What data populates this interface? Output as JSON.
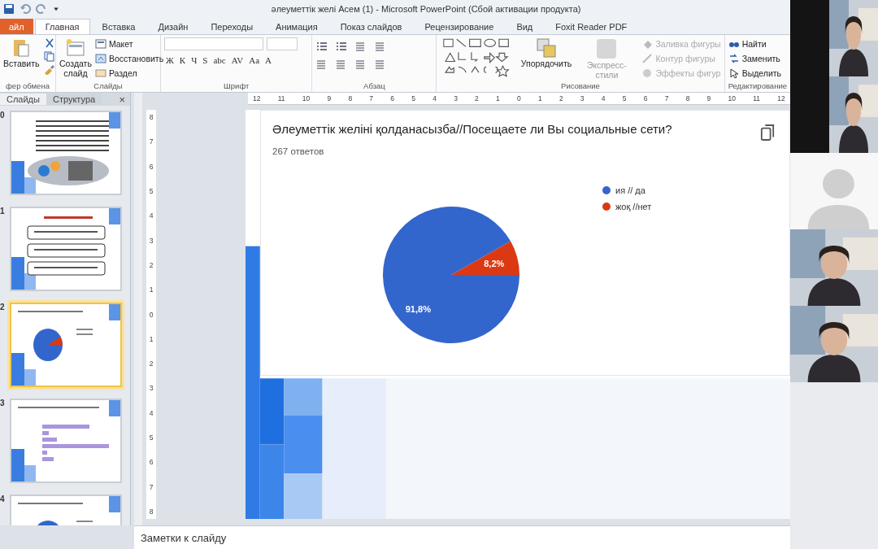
{
  "window": {
    "title": "әлеуметтік желі Асем (1)  -  Microsoft PowerPoint (Сбой активации продукта)"
  },
  "ribbon_tabs": [
    {
      "label": "айл",
      "kind": "file",
      "selected": false
    },
    {
      "label": "Главная",
      "kind": "tab",
      "selected": true
    },
    {
      "label": "Вставка",
      "kind": "tab",
      "selected": false
    },
    {
      "label": "Дизайн",
      "kind": "tab",
      "selected": false
    },
    {
      "label": "Переходы",
      "kind": "tab",
      "selected": false
    },
    {
      "label": "Анимация",
      "kind": "tab",
      "selected": false
    },
    {
      "label": "Показ слайдов",
      "kind": "tab",
      "selected": false
    },
    {
      "label": "Рецензирование",
      "kind": "tab",
      "selected": false
    },
    {
      "label": "Вид",
      "kind": "tab",
      "selected": false
    },
    {
      "label": "Foxit Reader PDF",
      "kind": "tab",
      "selected": false
    }
  ],
  "ribbon": {
    "clipboard": {
      "label": "фер обмена",
      "paste": "Вставить"
    },
    "slides": {
      "label": "Слайды",
      "new_slide": "Создать слайд",
      "layout": "Макет",
      "reset": "Восстановить",
      "section": "Раздел"
    },
    "font": {
      "label": "Шрифт",
      "buttons": [
        "Ж",
        "К",
        "Ч",
        "S",
        "abc",
        "AV",
        "Aa",
        "A"
      ]
    },
    "paragraph": {
      "label": "Абзац"
    },
    "drawing": {
      "label": "Рисование",
      "arrange": "Упорядочить",
      "quick_styles": "Экспресс-стили",
      "shape_options": [
        {
          "label": "Заливка фигуры",
          "disabled": true
        },
        {
          "label": "Контур фигуры",
          "disabled": true
        },
        {
          "label": "Эффекты фигур",
          "disabled": true
        }
      ]
    },
    "editing": {
      "label": "Редактирование",
      "items": [
        "Найти",
        "Заменить",
        "Выделить"
      ]
    }
  },
  "side_panel": {
    "tabs": [
      {
        "label": "Слайды",
        "selected": true
      },
      {
        "label": "Структура",
        "selected": false
      }
    ],
    "close": "×",
    "slides": [
      {
        "number": "0",
        "kind": "text",
        "selected": false
      },
      {
        "number": "1",
        "kind": "boxes",
        "selected": false
      },
      {
        "number": "2",
        "kind": "pie",
        "selected": true
      },
      {
        "number": "3",
        "kind": "bars",
        "selected": false
      },
      {
        "number": "4",
        "kind": "pie",
        "selected": false
      }
    ]
  },
  "ruler": {
    "horizontal": [
      "12",
      "11",
      "10",
      "9",
      "8",
      "7",
      "6",
      "5",
      "4",
      "3",
      "2",
      "1",
      "0",
      "1",
      "2",
      "3",
      "4",
      "5",
      "6",
      "7",
      "8",
      "9",
      "10",
      "11",
      "12"
    ],
    "vertical": [
      "8",
      "7",
      "6",
      "5",
      "4",
      "3",
      "2",
      "1",
      "0",
      "1",
      "2",
      "3",
      "4",
      "5",
      "6",
      "7",
      "8"
    ]
  },
  "slide": {
    "title": "Әлеуметтік желіні қолданасызба//Посещаете ли Вы социальные сети?",
    "responses": "267 ответов",
    "legend": [
      {
        "color": "#3366cc"
      },
      {
        "color": "#dc3912"
      }
    ],
    "chart_data": {
      "type": "pie",
      "categories": [
        "ия // да",
        "жоқ //нет"
      ],
      "values": [
        91.8,
        8.2
      ],
      "value_labels": [
        "91,8%",
        "8,2%"
      ]
    }
  },
  "notes": {
    "placeholder": "Заметки к слайду"
  },
  "participants": [
    {
      "kind": "camera"
    },
    {
      "kind": "camera"
    },
    {
      "kind": "avatar"
    },
    {
      "kind": "camera"
    },
    {
      "kind": "camera"
    }
  ]
}
